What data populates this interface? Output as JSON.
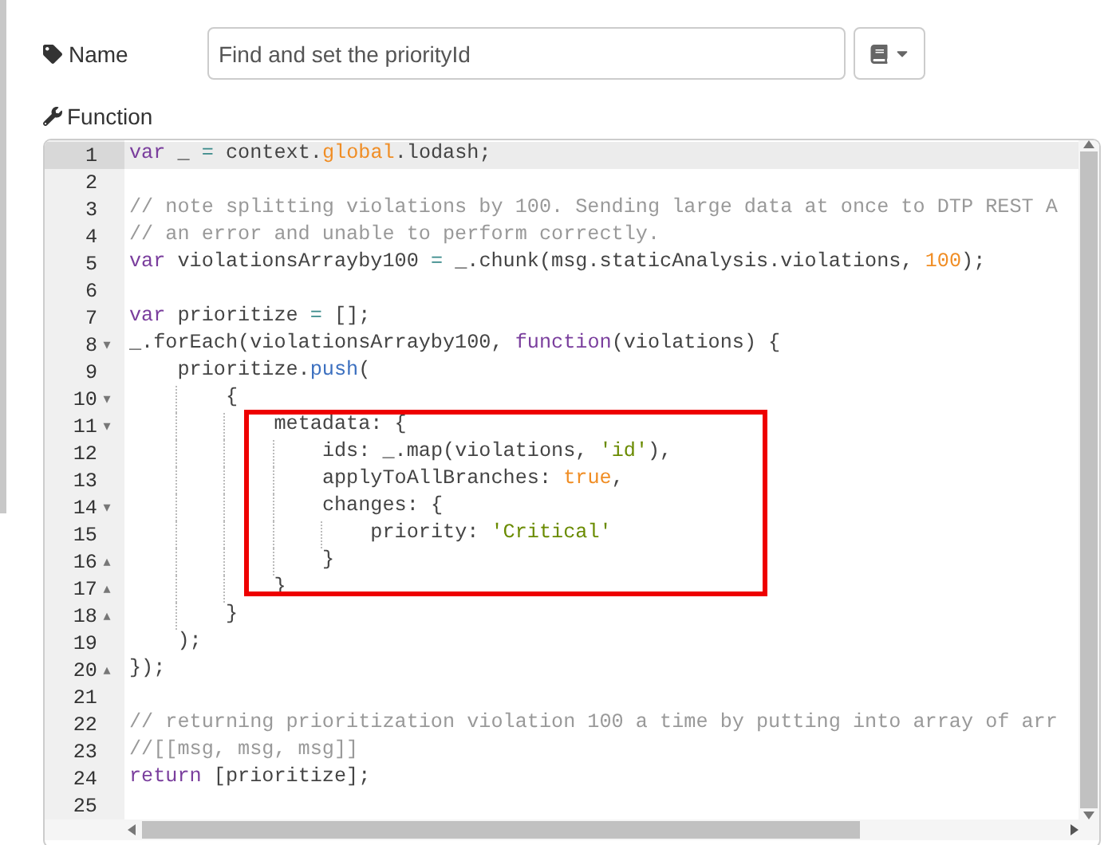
{
  "name_field": {
    "label": "Name",
    "value": "Find and set the priorityId"
  },
  "function_editor": {
    "label": "Function",
    "lines": [
      {
        "number": "1",
        "active": true,
        "tokens": [
          {
            "kind": "keyword",
            "text": "var"
          },
          {
            "kind": "plain",
            "text": " _ "
          },
          {
            "kind": "operator",
            "text": "="
          },
          {
            "kind": "plain",
            "text": " context."
          },
          {
            "kind": "atom",
            "text": "global"
          },
          {
            "kind": "plain",
            "text": ".lodash;"
          }
        ]
      },
      {
        "number": "2",
        "active": false
      },
      {
        "number": "3",
        "active": false,
        "tokens": [
          {
            "kind": "comment",
            "text": "// note splitting violations by 100. Sending large data at once to DTP REST A"
          }
        ]
      },
      {
        "number": "4",
        "active": false,
        "tokens": [
          {
            "kind": "comment",
            "text": "// an error and unable to perform correctly."
          }
        ]
      },
      {
        "number": "5",
        "active": false,
        "tokens": [
          {
            "kind": "keyword",
            "text": "var"
          },
          {
            "kind": "plain",
            "text": " violationsArrayby100 "
          },
          {
            "kind": "operator",
            "text": "="
          },
          {
            "kind": "plain",
            "text": " _.chunk(msg.staticAnalysis.violations, "
          },
          {
            "kind": "atom",
            "text": "100"
          },
          {
            "kind": "plain",
            "text": ");"
          }
        ]
      },
      {
        "number": "6",
        "active": false
      },
      {
        "number": "7",
        "active": false,
        "tokens": [
          {
            "kind": "keyword",
            "text": "var"
          },
          {
            "kind": "plain",
            "text": " prioritize "
          },
          {
            "kind": "operator",
            "text": "="
          },
          {
            "kind": "plain",
            "text": " [];"
          }
        ]
      },
      {
        "number": "8",
        "active": false,
        "fold": "▾",
        "tokens": [
          {
            "kind": "plain",
            "text": "_.forEach(violationsArrayby100, "
          },
          {
            "kind": "keyword",
            "text": "function"
          },
          {
            "kind": "plain",
            "text": "(violations) {"
          }
        ]
      },
      {
        "number": "9",
        "active": false,
        "tokens": [
          {
            "kind": "plain",
            "text": "    prioritize."
          },
          {
            "kind": "method",
            "text": "push"
          },
          {
            "kind": "plain",
            "text": "("
          }
        ]
      },
      {
        "number": "10",
        "active": false,
        "fold": "▾",
        "tokens": [
          {
            "kind": "plain",
            "text": "        {"
          }
        ]
      },
      {
        "number": "11",
        "active": false,
        "fold": "▾",
        "tokens": [
          {
            "kind": "plain",
            "text": "            metadata: {"
          }
        ]
      },
      {
        "number": "12",
        "active": false,
        "tokens": [
          {
            "kind": "plain",
            "text": "                ids: _.map(violations, "
          },
          {
            "kind": "string",
            "text": "'id'"
          },
          {
            "kind": "plain",
            "text": "),"
          }
        ]
      },
      {
        "number": "13",
        "active": false,
        "tokens": [
          {
            "kind": "plain",
            "text": "                applyToAllBranches: "
          },
          {
            "kind": "atom",
            "text": "true"
          },
          {
            "kind": "plain",
            "text": ","
          }
        ]
      },
      {
        "number": "14",
        "active": false,
        "fold": "▾",
        "tokens": [
          {
            "kind": "plain",
            "text": "                changes: {"
          }
        ]
      },
      {
        "number": "15",
        "active": false,
        "tokens": [
          {
            "kind": "plain",
            "text": "                    priority: "
          },
          {
            "kind": "string",
            "text": "'Critical'"
          }
        ]
      },
      {
        "number": "16",
        "active": false,
        "fold": "▴",
        "tokens": [
          {
            "kind": "plain",
            "text": "                }"
          }
        ]
      },
      {
        "number": "17",
        "active": false,
        "fold": "▴",
        "tokens": [
          {
            "kind": "plain",
            "text": "            }"
          }
        ]
      },
      {
        "number": "18",
        "active": false,
        "fold": "▴",
        "tokens": [
          {
            "kind": "plain",
            "text": "        }"
          }
        ]
      },
      {
        "number": "19",
        "active": false,
        "tokens": [
          {
            "kind": "plain",
            "text": "    );"
          }
        ]
      },
      {
        "number": "20",
        "active": false,
        "fold": "▴",
        "tokens": [
          {
            "kind": "plain",
            "text": "});"
          }
        ]
      },
      {
        "number": "21",
        "active": false
      },
      {
        "number": "22",
        "active": false,
        "tokens": [
          {
            "kind": "comment",
            "text": "// returning prioritization violation 100 a time by putting into array of arr"
          }
        ]
      },
      {
        "number": "23",
        "active": false,
        "tokens": [
          {
            "kind": "comment",
            "text": "//[[msg, msg, msg]]"
          }
        ]
      },
      {
        "number": "24",
        "active": false,
        "tokens": [
          {
            "kind": "keyword",
            "text": "return"
          },
          {
            "kind": "plain",
            "text": " [prioritize];"
          }
        ]
      },
      {
        "number": "25",
        "active": false
      }
    ]
  }
}
